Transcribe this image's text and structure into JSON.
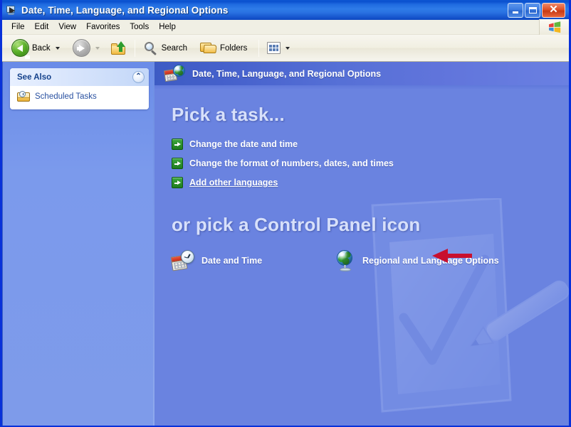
{
  "window": {
    "title": "Date, Time, Language, and Regional Options",
    "title_icon": "control-panel-arrow-icon",
    "buttons": {
      "minimize": "_",
      "maximize": "□",
      "close": "✕"
    }
  },
  "menubar": {
    "items": [
      {
        "label": "File"
      },
      {
        "label": "Edit"
      },
      {
        "label": "View"
      },
      {
        "label": "Favorites"
      },
      {
        "label": "Tools"
      },
      {
        "label": "Help"
      }
    ],
    "brand_icon": "windows-flag-icon"
  },
  "toolbar": {
    "back_label": "Back",
    "back_icon": "back-arrow-icon",
    "forward_icon": "forward-arrow-icon",
    "up_icon": "up-one-level-icon",
    "search_label": "Search",
    "search_icon": "search-magnifier-icon",
    "folders_label": "Folders",
    "folders_icon": "folders-icon",
    "views_icon": "views-icon"
  },
  "sidebar": {
    "panel_title": "See Also",
    "collapse_icon": "chevron-up-icon",
    "items": [
      {
        "label": "Scheduled Tasks",
        "icon": "scheduled-tasks-icon"
      }
    ]
  },
  "content": {
    "header_title": "Date, Time, Language, and Regional Options",
    "header_icon": "date-time-language-icon",
    "task_section_title": "Pick a task...",
    "tasks": [
      {
        "label": "Change the date and time",
        "icon": "green-arrow-icon",
        "hovered": false
      },
      {
        "label": "Change the format of numbers, dates, and times",
        "icon": "green-arrow-icon",
        "hovered": false
      },
      {
        "label": "Add other languages",
        "icon": "green-arrow-icon",
        "hovered": true
      }
    ],
    "cp_section_title": "or pick a Control Panel icon",
    "cp_icons": [
      {
        "label": "Date and Time",
        "icon": "date-and-time-icon"
      },
      {
        "label": "Regional and Language Options",
        "icon": "globe-icon"
      }
    ],
    "watermark_icon": "clipboard-checkmark-pen-watermark"
  },
  "annotation": {
    "arrow_icon": "red-pointer-arrow",
    "color": "#C8102E",
    "points_at": "Add other languages"
  },
  "colors": {
    "titlebar_blue": "#0A50CF",
    "panel_blue": "#6A83E0",
    "sidebar_blue": "#7B9AEC",
    "heading_text": "#D7E0FA",
    "link_blue": "#2850A0",
    "green_arrow": "#1E7C1E",
    "annotation_red": "#C8102E"
  }
}
